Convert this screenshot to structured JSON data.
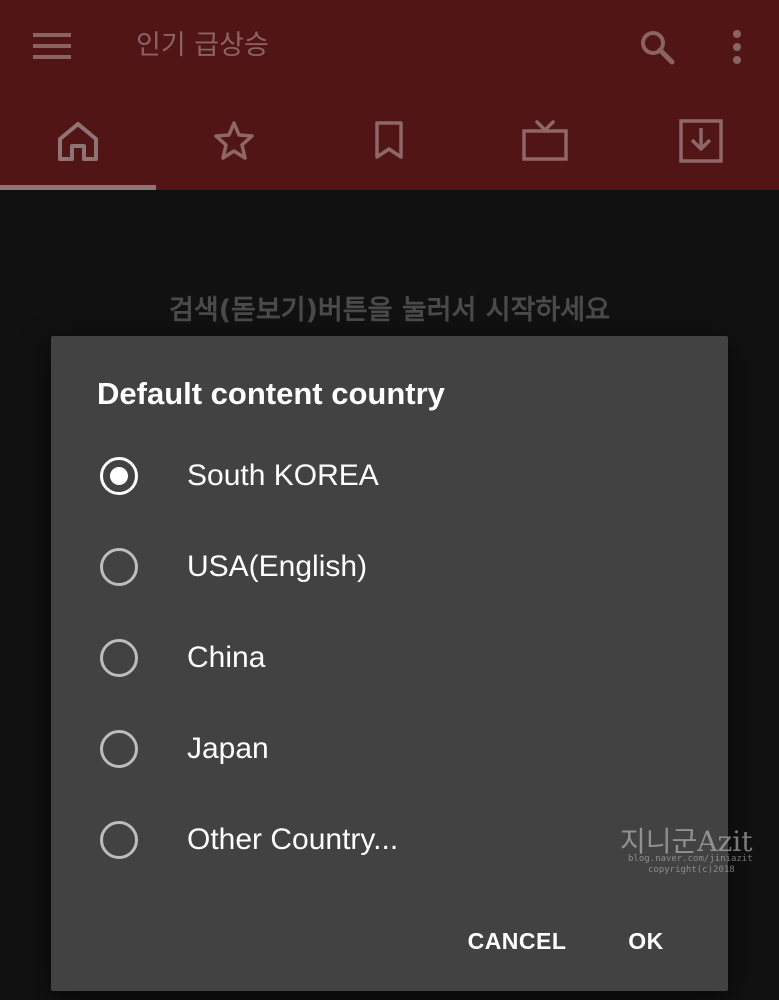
{
  "appbar": {
    "title": "인기 급상승",
    "icons": [
      "menu-icon",
      "search-icon",
      "more-vert-icon"
    ],
    "background": "#511516"
  },
  "tabs": [
    {
      "icon": "home-icon",
      "selected": true
    },
    {
      "icon": "star-icon",
      "selected": false
    },
    {
      "icon": "bookmark-icon",
      "selected": false
    },
    {
      "icon": "tv-icon",
      "selected": false
    },
    {
      "icon": "download-icon",
      "selected": false
    }
  ],
  "main": {
    "hint": "검색(돋보기)버튼을 눌러서 시작하세요"
  },
  "dialog": {
    "title": "Default content country",
    "options": [
      {
        "label": "South KOREA",
        "checked": true
      },
      {
        "label": "USA(English)",
        "checked": false
      },
      {
        "label": "China",
        "checked": false
      },
      {
        "label": "Japan",
        "checked": false
      },
      {
        "label": "Other Country...",
        "checked": false
      }
    ],
    "cancel_label": "CANCEL",
    "ok_label": "OK",
    "background": "#424242"
  },
  "watermark": {
    "main": "지니군Azit",
    "line1": "blog.naver.com/jiniazit",
    "line2": "copyright(c)2018"
  }
}
